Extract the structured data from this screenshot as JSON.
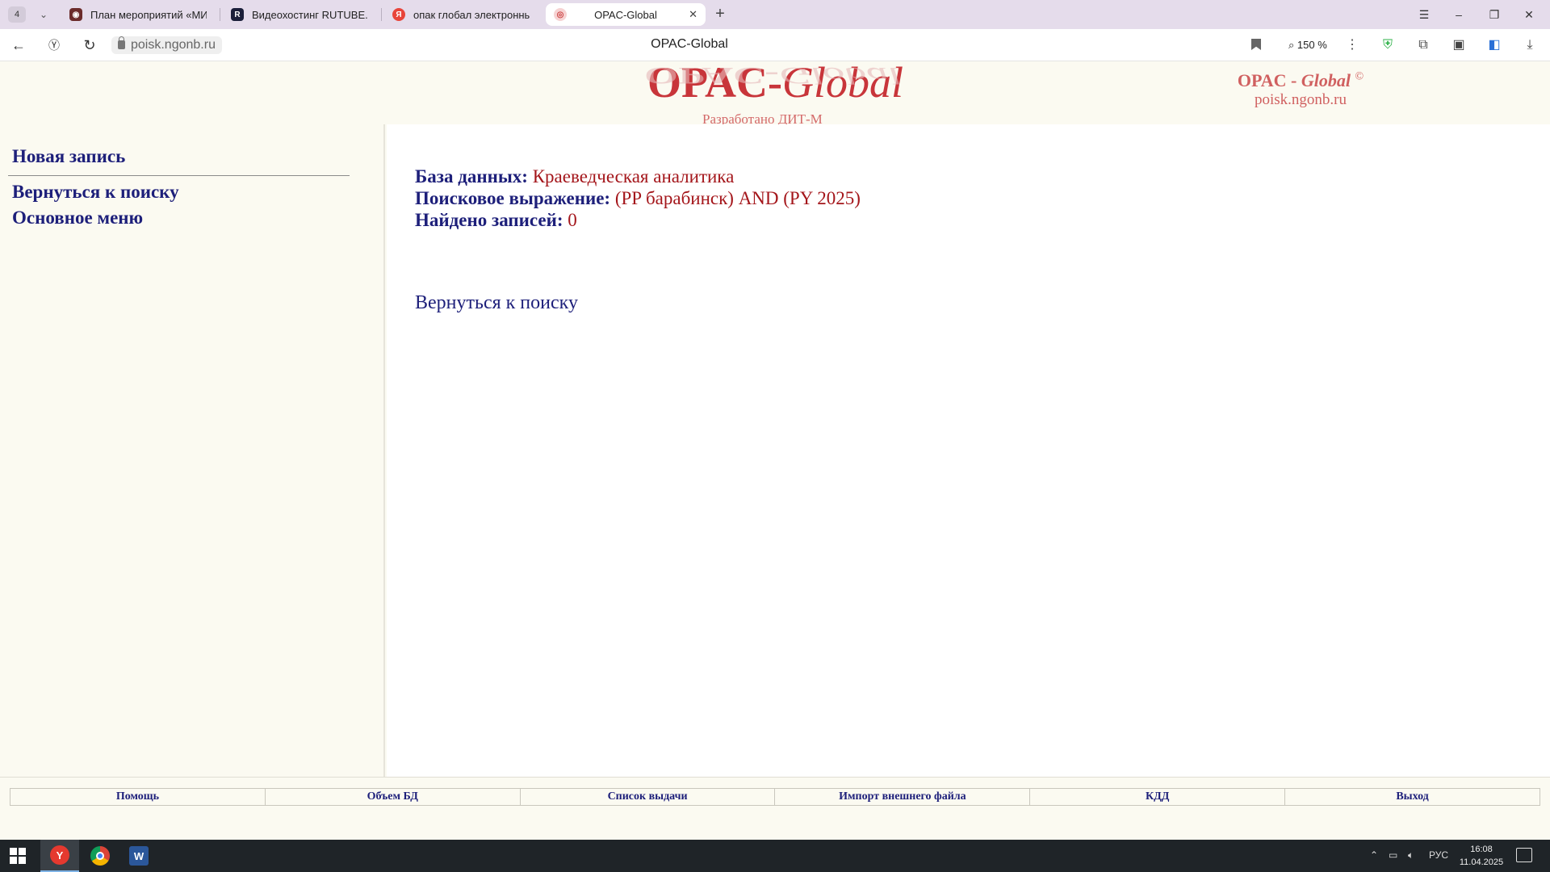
{
  "browser": {
    "tab_count": "4",
    "tabs": [
      {
        "label": "План мероприятий «МИБ",
        "favicon_color": "#6b2b2b"
      },
      {
        "label": "Видеохостинг RUTUBE. С",
        "favicon_color": "#1b1f3a"
      },
      {
        "label": "опак глобал электронный",
        "favicon_color": "#e8443a"
      },
      {
        "label": "OPAC-Global",
        "favicon_color": "#f2b3b3",
        "active": true
      }
    ],
    "url": "poisk.ngonb.ru",
    "page_title": "OPAC-Global",
    "zoom": "150 %"
  },
  "header": {
    "logo_left": "OPAC-",
    "logo_right": "Global",
    "developer": "Разработано ДИТ-М",
    "brand_name_left": "OPAC -",
    "brand_name_right": "Global",
    "brand_copyright": "©",
    "brand_site": "poisk.ngonb.ru"
  },
  "left_menu": {
    "new_record": "Новая запись",
    "back_to_search": "Вернуться к поиску",
    "main_menu": "Основное меню"
  },
  "main": {
    "db_label": "База данных:",
    "db_value": "Краеведческая аналитика",
    "query_label": "Поисковое выражение:",
    "query_value": "(PP барабинск) AND (PY 2025)",
    "found_label": "Найдено записей:",
    "found_value": "0",
    "back_link": "Вернуться к поиску"
  },
  "footer_menu": [
    "Помощь",
    "Объем БД",
    "Список выдачи",
    "Импорт внешнего файла",
    "КДД",
    "Выход"
  ],
  "taskbar": {
    "lang": "РУС",
    "time": "16:08",
    "date": "11.04.2025"
  }
}
